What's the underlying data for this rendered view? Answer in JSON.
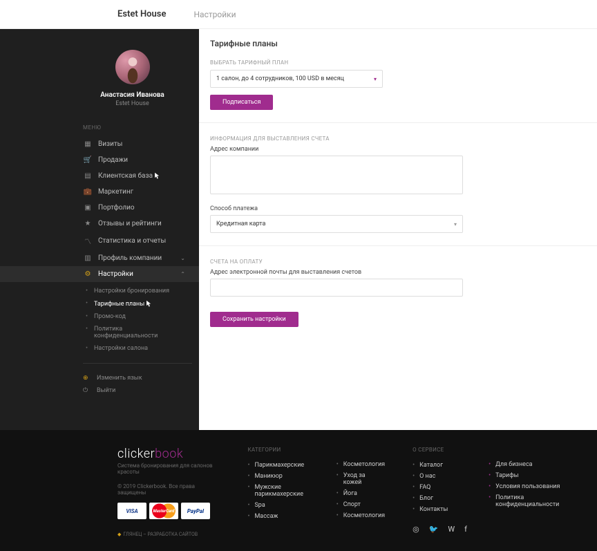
{
  "header": {
    "title": "Estet House",
    "section": "Настройки"
  },
  "profile": {
    "name": "Анастасия Иванова",
    "company": "Estet House"
  },
  "menuLabel": "МЕНЮ",
  "menu": [
    {
      "label": "Визиты"
    },
    {
      "label": "Продажи"
    },
    {
      "label": "Клиентская база"
    },
    {
      "label": "Маркетинг"
    },
    {
      "label": "Портфолио"
    },
    {
      "label": "Отзывы и рейтинги"
    },
    {
      "label": "Статистика и отчеты"
    },
    {
      "label": "Профиль компании"
    },
    {
      "label": "Настройки"
    }
  ],
  "submenu": [
    {
      "label": "Настройки бронирования"
    },
    {
      "label": "Тарифные планы"
    },
    {
      "label": "Промо-код"
    },
    {
      "label": "Политика конфиденциальности"
    },
    {
      "label": "Настройки салона"
    }
  ],
  "utility": {
    "lang": "Изменить язык",
    "logout": "Выйти"
  },
  "page": {
    "title": "Тарифные планы",
    "planLabel": "ВЫБРАТЬ ТАРИФНЫЙ ПЛАН",
    "planValue": "1 салон, до 4 сотрудников, 100 USD в месяц",
    "subscribe": "Подписаться",
    "billingLabel": "ИНФОРМАЦИЯ ДЛЯ ВЫСТАВЛЕНИЯ СЧЕТА",
    "addressLabel": "Адрес компании",
    "payMethodLabel": "Способ платежа",
    "payMethodValue": "Кредитная карта",
    "invoiceLabel": "СЧЕТА НА ОПЛАТУ",
    "emailLabel": "Адрес электронной почты для выставления счетов",
    "save": "Сохранить настройки"
  },
  "footer": {
    "logo1": "clicker",
    "logo2": "book",
    "tagline": "Система бронирования для салонов красоты",
    "copy": "© 2019 Clickerbook. Все права защищены",
    "credit": "ГЛЯНЕЦ – РАЗРАБОТКА САЙТОВ",
    "catHead": "КАТЕГОРИИ",
    "cat1": [
      "Парикмахерские",
      "Маникюр",
      "Мужские парикмахерские",
      "Spa",
      "Массаж"
    ],
    "cat2": [
      "Косметология",
      "Уход за кожей",
      "Йога",
      "Спорт",
      "Косметология"
    ],
    "svcHead": "О СЕРВИСЕ",
    "svc1": [
      "Каталог",
      "О нас",
      "FAQ",
      "Блог",
      "Контакты"
    ],
    "svc2": [
      "Для бизнеса",
      "Тарифы",
      "Условия пользования",
      "Политика конфиденциальности"
    ]
  }
}
